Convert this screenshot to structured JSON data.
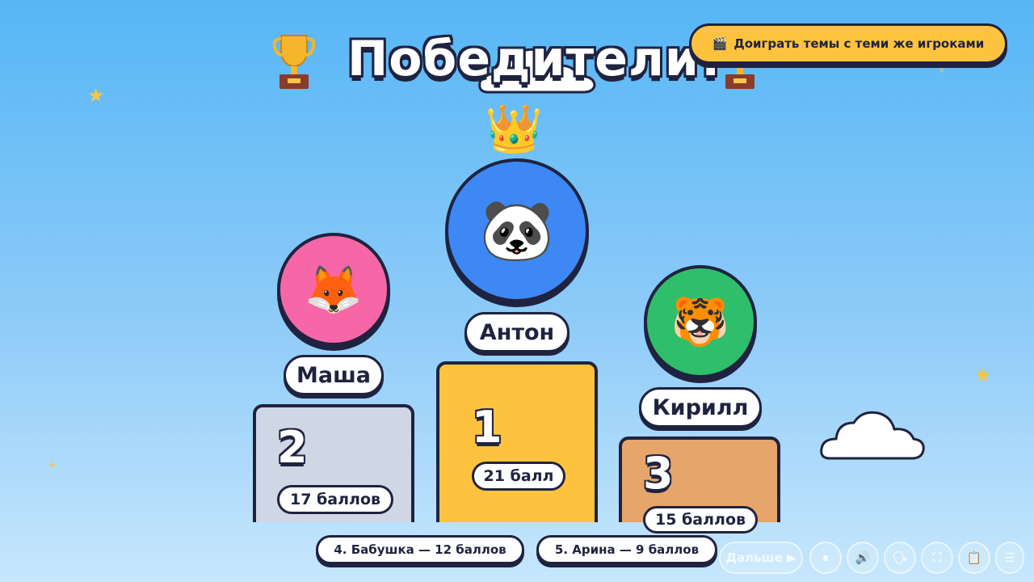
{
  "header": {
    "title": "Победители!",
    "replay_icon": "🎬",
    "replay_label": "Доиграть темы с теми же игроками"
  },
  "podium": [
    {
      "place": "1",
      "name": "Антон",
      "score": "21 балл",
      "avatar_icon": "🐼",
      "avatar_color": "#3d88f5",
      "pedestal_color": "#fdc33f",
      "crown_icon": "👑"
    },
    {
      "place": "2",
      "name": "Маша",
      "score": "17 баллов",
      "avatar_icon": "🦊",
      "avatar_color": "#f767a8",
      "pedestal_color": "#cfd6e4"
    },
    {
      "place": "3",
      "name": "Кирилл",
      "score": "15 баллов",
      "avatar_icon": "🐯",
      "avatar_color": "#2fbf6b",
      "pedestal_color": "#e6a56a"
    }
  ],
  "others": [
    "4. Бабушка — 12 баллов",
    "5. Арина — 9 баллов"
  ],
  "controls": {
    "next_label": "Дальше ▶",
    "pause_icon": "⏸",
    "volume_icon": "🔊",
    "voice_icon": "🗣",
    "fullscreen_icon": "⛶",
    "rules_icon": "📋",
    "menu_icon": "☰"
  }
}
